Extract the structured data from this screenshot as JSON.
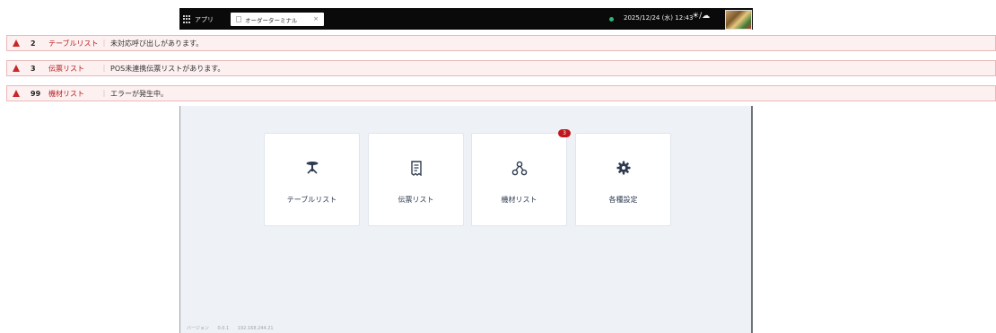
{
  "topbar": {
    "apps_label": "アプリ",
    "tab_title": "オーダーターミナル",
    "tab_close": "×",
    "datetime": "2025/12/24 (水) 12:43",
    "weather_icons": "sun-icon / cloud-icon",
    "status_color": "#2bb673"
  },
  "alerts": [
    {
      "count": "2",
      "name": "テーブルリスト",
      "message": "未対応呼び出しがあります。"
    },
    {
      "count": "3",
      "name": "伝票リスト",
      "message": "POS未連携伝票リストがあります。"
    },
    {
      "count": "99",
      "name": "機材リスト",
      "message": "エラーが発生中。"
    }
  ],
  "menu": {
    "tiles": [
      {
        "label": "テーブルリスト",
        "icon": "table-icon"
      },
      {
        "label": "伝票リスト",
        "icon": "receipt-icon"
      },
      {
        "label": "機材リスト",
        "icon": "network-icon",
        "badge": "3"
      },
      {
        "label": "各種設定",
        "icon": "gear-icon"
      }
    ]
  },
  "footer": {
    "version_label": "バージョン",
    "version": "0.0.1",
    "ip": "192.168.244.21"
  },
  "colors": {
    "alert_red": "#c62828",
    "badge_red": "#c0171d",
    "icon_navy": "#2d3a4f"
  }
}
